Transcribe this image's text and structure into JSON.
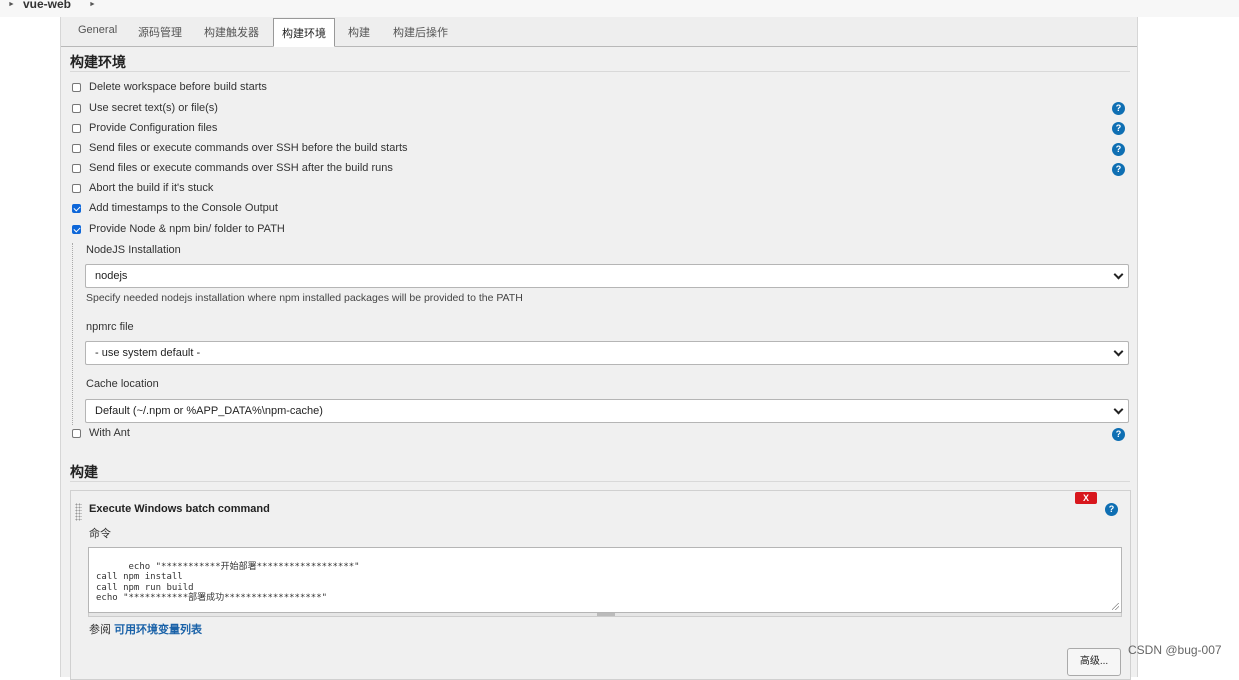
{
  "breadcrumb": {
    "item": "vue-web"
  },
  "tabs": [
    {
      "label": "General"
    },
    {
      "label": "源码管理"
    },
    {
      "label": "构建触发器"
    },
    {
      "label": "构建环境"
    },
    {
      "label": "构建"
    },
    {
      "label": "构建后操作"
    }
  ],
  "active_tab_index": 3,
  "build_env": {
    "title": "构建环境",
    "options": [
      {
        "label": "Delete workspace before build starts",
        "checked": false,
        "help": false
      },
      {
        "label": "Use secret text(s) or file(s)",
        "checked": false,
        "help": true
      },
      {
        "label": "Provide Configuration files",
        "checked": false,
        "help": true
      },
      {
        "label": "Send files or execute commands over SSH before the build starts",
        "checked": false,
        "help": true
      },
      {
        "label": "Send files or execute commands over SSH after the build runs",
        "checked": false,
        "help": true
      },
      {
        "label": "Abort the build if it's stuck",
        "checked": false,
        "help": false
      },
      {
        "label": "Add timestamps to the Console Output",
        "checked": true,
        "help": false
      },
      {
        "label": "Provide Node & npm bin/ folder to PATH",
        "checked": true,
        "help": false
      }
    ],
    "node": {
      "nodejs_label": "NodeJS Installation",
      "nodejs_value": "nodejs",
      "nodejs_desc": "Specify needed nodejs installation where npm installed packages will be provided to the PATH",
      "npmrc_label": "npmrc file",
      "npmrc_value": "- use system default -",
      "cache_label": "Cache location",
      "cache_value": "Default (~/.npm or %APP_DATA%\\npm-cache)"
    },
    "with_ant": {
      "label": "With Ant",
      "checked": false,
      "help": true
    }
  },
  "build": {
    "title": "构建",
    "step_title": "Execute Windows batch command",
    "delete_label": "X",
    "command_label": "命令",
    "command_text": "echo \"***********开始部署******************\"\ncall npm install\ncall npm run build\necho \"***********部署成功******************\"",
    "see_also_prefix": "参阅 ",
    "see_also_link": "可用环境变量列表",
    "advanced_label": "高级..."
  },
  "help_glyph": "?",
  "watermark": "CSDN @bug-007",
  "colors": {
    "help": "#0f6fb3",
    "checkbox_checked": "#0e67d9",
    "delete": "#d8171d",
    "link": "#1a62a8"
  }
}
